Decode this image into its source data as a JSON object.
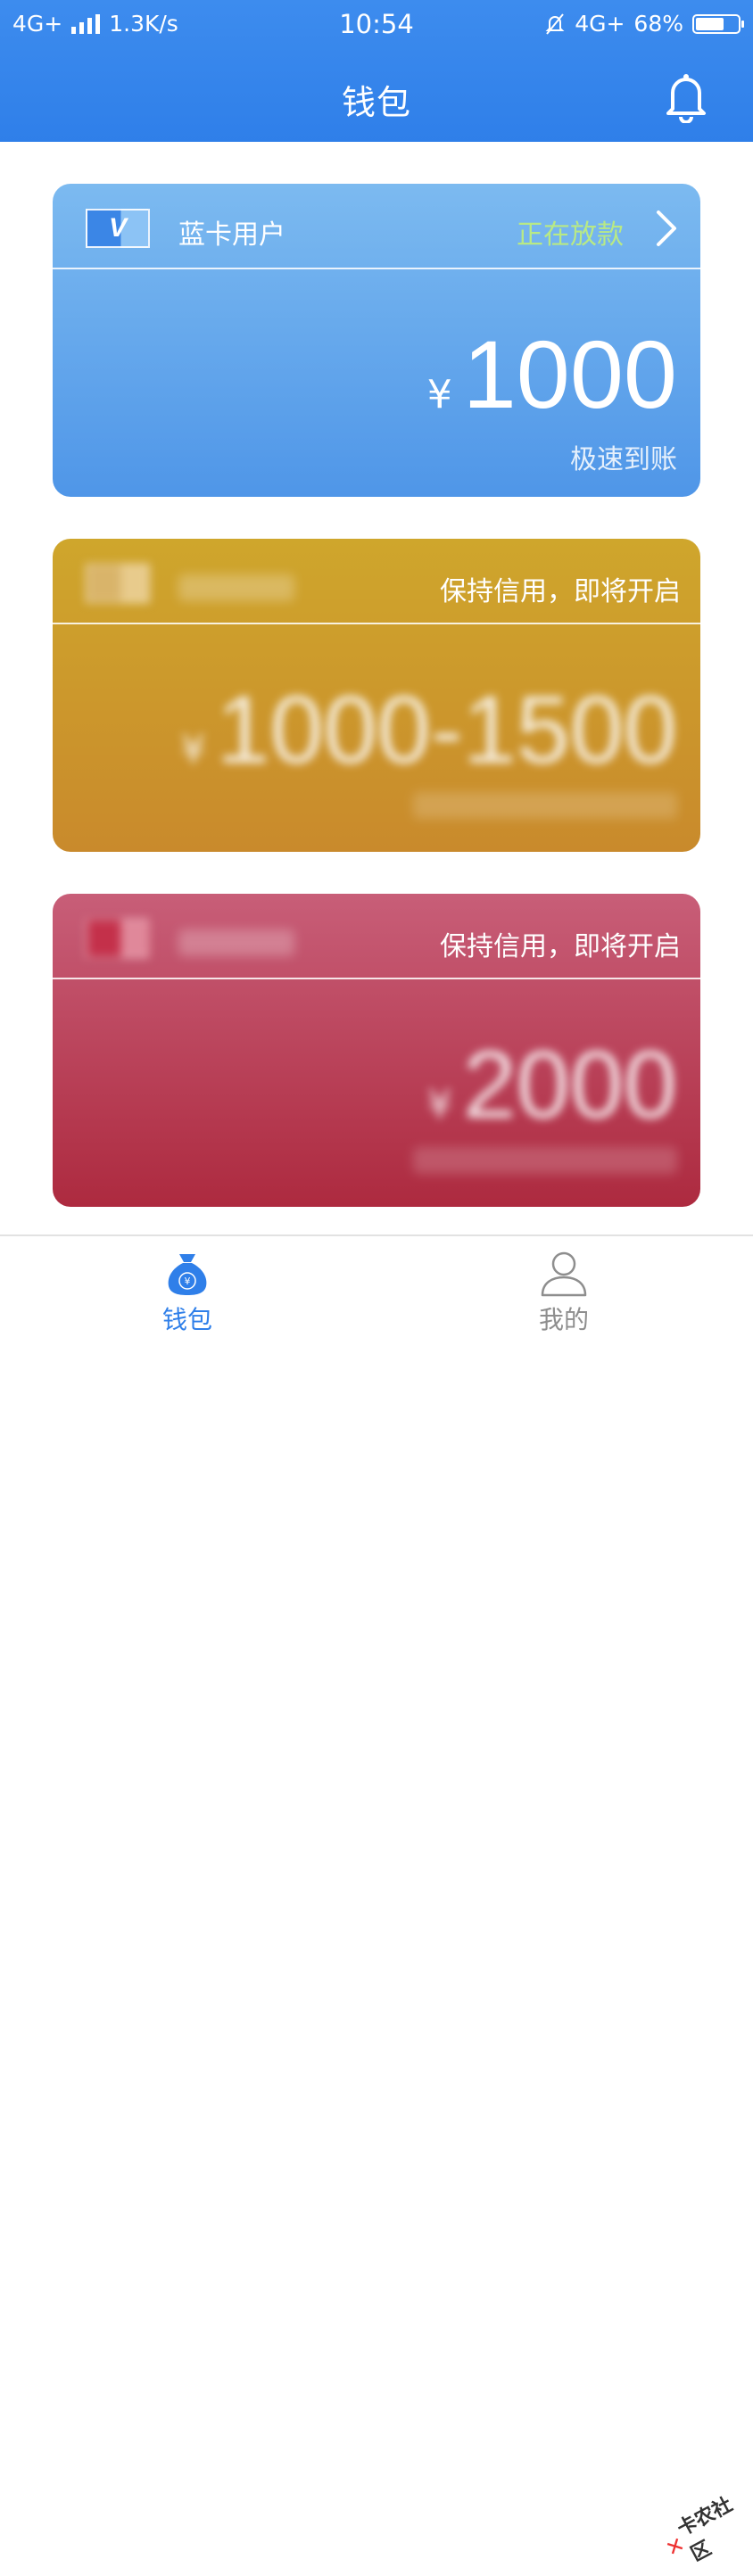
{
  "status_bar": {
    "network": "4G+",
    "speed": "1.3K/s",
    "time": "10:54",
    "network_right": "4G+",
    "battery_percent": "68%",
    "battery_level": 0.68
  },
  "header": {
    "title": "钱包"
  },
  "cards": {
    "blue": {
      "badge": "V",
      "name": "蓝卡用户",
      "status": "正在放款",
      "currency": "¥",
      "amount": "1000",
      "subtitle": "极速到账"
    },
    "gold": {
      "hint": "保持信用，即将开启",
      "currency": "¥",
      "amount": "1000-1500"
    },
    "red": {
      "hint": "保持信用，即将开启",
      "currency": "¥",
      "amount": "2000"
    }
  },
  "bottom_nav": {
    "wallet_label": "钱包",
    "mine_label": "我的"
  },
  "watermark": {
    "text": "卡农社区"
  },
  "colors": {
    "header_blue": "#2f7fe9",
    "status_green": "#b8e986",
    "gold_card": "#c99a2c",
    "red_card": "#b3354d"
  }
}
